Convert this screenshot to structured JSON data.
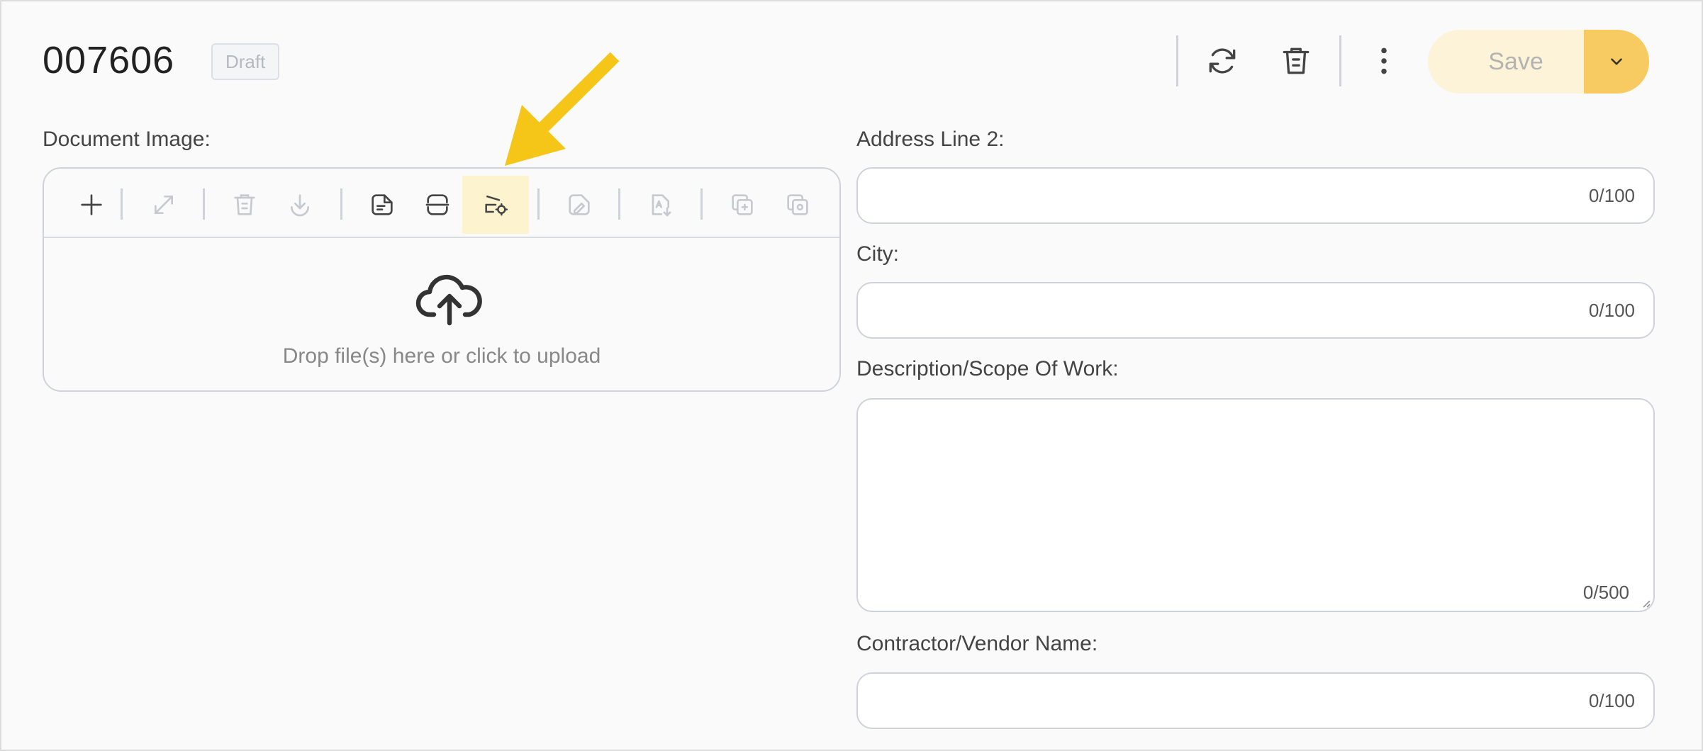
{
  "header": {
    "doc_id": "007606",
    "status": "Draft",
    "save_label": "Save",
    "icons": [
      "refresh-icon",
      "trash-icon",
      "more-vertical-icon",
      "chevron-down-icon"
    ]
  },
  "left": {
    "document_image_label": "Document Image:",
    "toolbar_icons": [
      "add-icon",
      "expand-icon",
      "delete-icon",
      "download-icon",
      "file-note-icon",
      "split-icon",
      "split-settings-icon",
      "sign-icon",
      "pdf-download-icon",
      "copy-add-icon",
      "copy-settings-icon"
    ],
    "upload_text": "Drop file(s) here or click to upload"
  },
  "fields": {
    "address2": {
      "label": "Address Line 2:",
      "counter": "0/100"
    },
    "city": {
      "label": "City:",
      "counter": "0/100"
    },
    "description": {
      "label": "Description/Scope Of Work:",
      "counter": "0/500"
    },
    "contractor": {
      "label": "Contractor/Vendor Name:",
      "counter": "0/100"
    }
  },
  "colors": {
    "accent": "#f8cb62",
    "arrow": "#f5c518",
    "save_bg": "#fdf3d8"
  }
}
